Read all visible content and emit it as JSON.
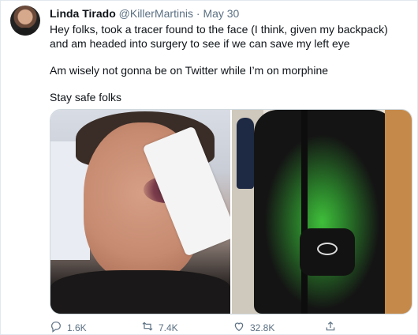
{
  "tweet": {
    "author_name": "Linda Tirado",
    "handle": "@KillerMartinis",
    "separator": "·",
    "date": "May 30",
    "paragraphs": [
      "Hey folks, took a tracer found to the face (I think, given my backpack) and am headed into surgery to see if we can save my left eye",
      "Am wisely not gonna be on Twitter while I’m on morphine",
      "Stay safe folks"
    ]
  },
  "actions": {
    "reply_count": "1.6K",
    "retweet_count": "7.4K",
    "like_count": "32.8K"
  },
  "icons": {
    "reply": "reply-icon",
    "retweet": "retweet-icon",
    "like": "heart-icon",
    "share": "share-icon"
  }
}
